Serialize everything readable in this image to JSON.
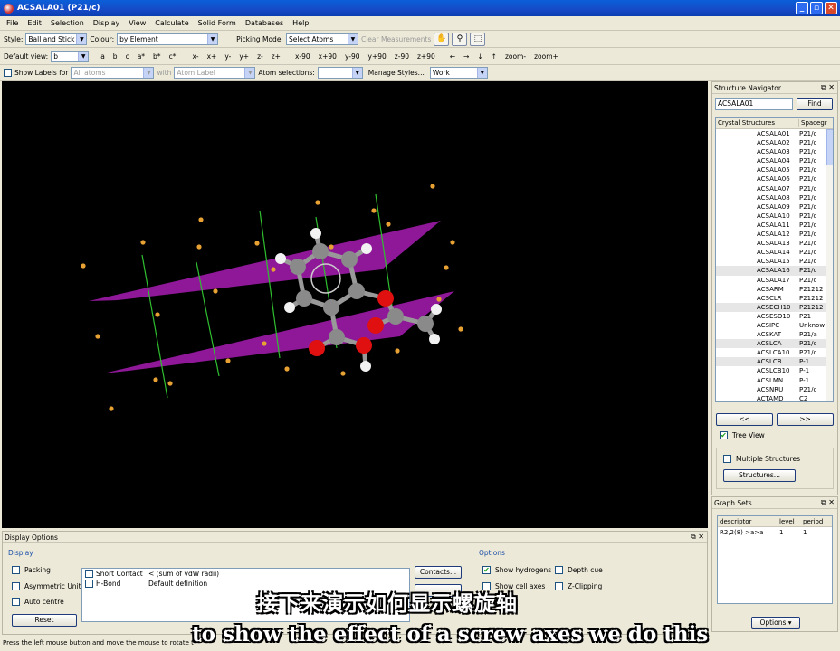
{
  "window": {
    "title": "ACSALA01 (P21/c)"
  },
  "menu": [
    "File",
    "Edit",
    "Selection",
    "Display",
    "View",
    "Calculate",
    "Solid Form",
    "Databases",
    "Help"
  ],
  "toolbar1": {
    "style_label": "Style:",
    "style_value": "Ball and Stick",
    "colour_label": "Colour:",
    "colour_value": "by Element",
    "picking_label": "Picking Mode:",
    "picking_value": "Select Atoms",
    "clear_label": "Clear Measurements"
  },
  "toolbar2": {
    "default_view_label": "Default view:",
    "default_view_value": "b",
    "axes": [
      "a",
      "b",
      "c",
      "a*",
      "b*",
      "c*"
    ],
    "rotations": [
      "x-",
      "x+",
      "y-",
      "y+",
      "z-",
      "z+",
      "x-90",
      "x+90",
      "y-90",
      "y+90",
      "z-90",
      "z+90"
    ],
    "arrows": [
      "←",
      "→",
      "↓",
      "↑"
    ],
    "zoom_minus": "zoom-",
    "zoom_plus": "zoom+"
  },
  "toolbar3": {
    "show_labels": "Show Labels for",
    "labels_value": "All atoms",
    "with_label": "with",
    "with_value": "Atom Label",
    "atom_sel_label": "Atom selections:",
    "atom_sel_value": "",
    "manage_styles": "Manage Styles...",
    "style_set": "Work"
  },
  "navigator": {
    "title": "Structure Navigator",
    "search_value": "ACSALA01",
    "find_label": "Find",
    "col1": "Crystal Structures",
    "col2": "Spacegr",
    "rows": [
      {
        "name": "ACSALA01",
        "sg": "P21/c"
      },
      {
        "name": "ACSALA02",
        "sg": "P21/c"
      },
      {
        "name": "ACSALA03",
        "sg": "P21/c"
      },
      {
        "name": "ACSALA04",
        "sg": "P21/c"
      },
      {
        "name": "ACSALA05",
        "sg": "P21/c"
      },
      {
        "name": "ACSALA06",
        "sg": "P21/c"
      },
      {
        "name": "ACSALA07",
        "sg": "P21/c"
      },
      {
        "name": "ACSALA08",
        "sg": "P21/c"
      },
      {
        "name": "ACSALA09",
        "sg": "P21/c"
      },
      {
        "name": "ACSALA10",
        "sg": "P21/c"
      },
      {
        "name": "ACSALA11",
        "sg": "P21/c"
      },
      {
        "name": "ACSALA12",
        "sg": "P21/c"
      },
      {
        "name": "ACSALA13",
        "sg": "P21/c"
      },
      {
        "name": "ACSALA14",
        "sg": "P21/c"
      },
      {
        "name": "ACSALA15",
        "sg": "P21/c"
      },
      {
        "name": "ACSALA16",
        "sg": "P21/c"
      },
      {
        "name": "ACSALA17",
        "sg": "P21/c"
      },
      {
        "name": "ACSARM",
        "sg": "P21212"
      },
      {
        "name": "ACSCLR",
        "sg": "P21212"
      },
      {
        "name": "ACSECH10",
        "sg": "P21212"
      },
      {
        "name": "ACSESO10",
        "sg": "P21"
      },
      {
        "name": "ACSIPC",
        "sg": "Unknow"
      },
      {
        "name": "ACSKAT",
        "sg": "P21/a"
      },
      {
        "name": "ACSLCA",
        "sg": "P21/c"
      },
      {
        "name": "ACSLCA10",
        "sg": "P21/c"
      },
      {
        "name": "ACSLCB",
        "sg": "P-1"
      },
      {
        "name": "ACSLCB10",
        "sg": "P-1"
      },
      {
        "name": "ACSLMN",
        "sg": "P-1"
      },
      {
        "name": "ACSNRU",
        "sg": "P21/c"
      },
      {
        "name": "ACTAMD",
        "sg": "C2"
      }
    ],
    "prev_label": "<<",
    "next_label": ">>",
    "tree_view": "Tree View",
    "multiple": "Multiple Structures",
    "structures_btn": "Structures..."
  },
  "graphsets": {
    "title": "Graph Sets",
    "cols": [
      "descriptor",
      "level",
      "period"
    ],
    "rows": [
      {
        "d": "R2,2(8) >a>a",
        "l": "1",
        "p": "1"
      }
    ],
    "options_btn": "Options"
  },
  "display": {
    "title": "Display Options",
    "section_display": "Display",
    "packing": "Packing",
    "asym": "Asymmetric Unit",
    "autocentre": "Auto centre",
    "reset": "Reset",
    "short_contact": "Short Contact",
    "short_contact_def": "< (sum of vdW radii)",
    "hbond": "H-Bond",
    "hbond_def": "Default definition",
    "contacts_btn": "Contacts...",
    "section_options": "Options",
    "show_h": "Show hydrogens",
    "depth_cue": "Depth cue",
    "cell_axes": "Show cell axes",
    "zclip": "Z-Clipping"
  },
  "statusbar": "Press the left mouse button and move the mouse to rotate t",
  "subtitles": {
    "cn": "接下来演示如何显示螺旋轴",
    "en": "to show the effect of a screw axes we do this"
  },
  "colors": {
    "plane": "#9b1aa6",
    "axis_line": "#2fbf2f",
    "oxygen": "#e01010",
    "carbon": "#8a8a8a",
    "hydrogen": "#f2f2f2",
    "centroid": "#e8a233"
  }
}
